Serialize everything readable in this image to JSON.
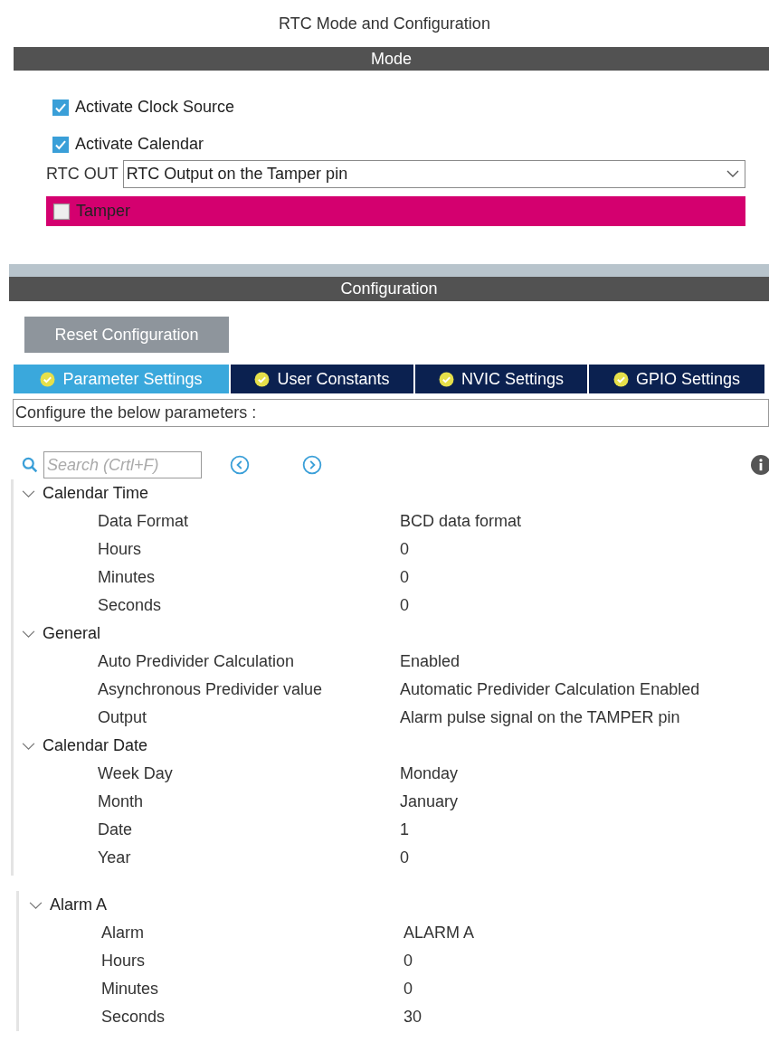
{
  "title": "RTC Mode and Configuration",
  "mode": {
    "title": "Mode",
    "checkboxes": [
      {
        "label": "Activate Clock Source",
        "checked": true
      },
      {
        "label": "Activate Calendar",
        "checked": true
      }
    ],
    "rtc_out": {
      "label": "RTC OUT",
      "value": "RTC Output on the Tamper pin"
    },
    "tamper": {
      "label": "Tamper",
      "checked": false
    }
  },
  "configuration": {
    "title": "Configuration",
    "reset_button": "Reset Configuration",
    "tabs": [
      {
        "label": "Parameter Settings",
        "selected": true
      },
      {
        "label": "User Constants",
        "selected": false
      },
      {
        "label": "NVIC Settings",
        "selected": false
      },
      {
        "label": "GPIO Settings",
        "selected": false
      }
    ],
    "description": "Configure the below parameters :",
    "search": {
      "placeholder": "Search (Crtl+F)"
    },
    "panels": [
      [
        {
          "label": "Calendar Time",
          "expanded": true,
          "params": [
            {
              "name": "Data Format",
              "value": "BCD data format"
            },
            {
              "name": "Hours",
              "value": "0"
            },
            {
              "name": "Minutes",
              "value": "0"
            },
            {
              "name": "Seconds",
              "value": "0"
            }
          ]
        },
        {
          "label": "General",
          "expanded": true,
          "params": [
            {
              "name": "Auto Predivider Calculation",
              "value": "Enabled"
            },
            {
              "name": "Asynchronous Predivider value",
              "value": "Automatic Predivider Calculation Enabled"
            },
            {
              "name": "Output",
              "value": "Alarm pulse signal on the TAMPER pin"
            }
          ]
        },
        {
          "label": "Calendar Date",
          "expanded": true,
          "params": [
            {
              "name": "Week Day",
              "value": "Monday"
            },
            {
              "name": "Month",
              "value": "January"
            },
            {
              "name": "Date",
              "value": "1"
            },
            {
              "name": "Year",
              "value": "0"
            }
          ]
        }
      ],
      [
        {
          "label": "Alarm A",
          "expanded": true,
          "params": [
            {
              "name": "Alarm",
              "value": "ALARM A"
            },
            {
              "name": "Hours",
              "value": "0"
            },
            {
              "name": "Minutes",
              "value": "0"
            },
            {
              "name": "Seconds",
              "value": "30"
            }
          ]
        }
      ]
    ]
  }
}
